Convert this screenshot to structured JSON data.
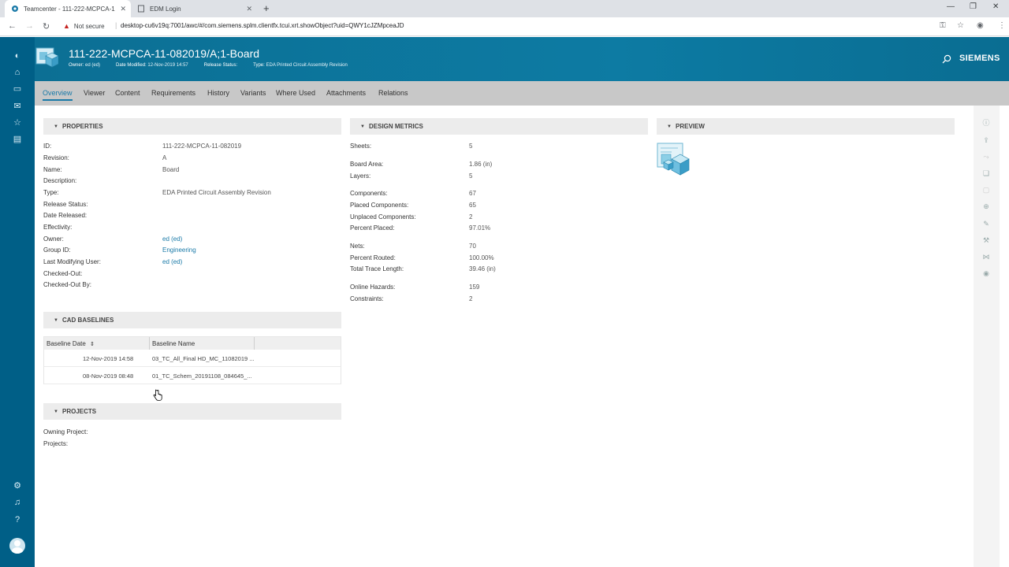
{
  "browser": {
    "tabs": [
      {
        "title": "Teamcenter - 111-222-MCPCA-1",
        "close": "✕"
      },
      {
        "title": "EDM Login",
        "close": "✕"
      }
    ],
    "new_tab": "+",
    "secure_label": "Not secure",
    "url": "desktop-cu6v19q:7001/awc/#/com.siemens.splm.clientfx.tcui.xrt.showObject?uid=QWY1cJZMpceaJD"
  },
  "header": {
    "title": "111-222-MCPCA-11-082019/A;1-Board",
    "meta": [
      {
        "label": "Owner:",
        "value": "ed (ed)"
      },
      {
        "label": "Date Modified:",
        "value": "12-Nov-2019 14:57"
      },
      {
        "label": "Release Status:",
        "value": ""
      },
      {
        "label": "Type:",
        "value": "EDA Printed Circuit Assembly Revision"
      }
    ],
    "brand": "SIEMENS"
  },
  "subtabs": [
    "Overview",
    "Viewer",
    "Content",
    "Requirements",
    "History",
    "Variants",
    "Where Used",
    "Attachments",
    "Relations"
  ],
  "properties": {
    "title": "PROPERTIES",
    "rows": [
      {
        "label": "ID:",
        "value": "111-222-MCPCA-11-082019"
      },
      {
        "label": "Revision:",
        "value": "A"
      },
      {
        "label": "Name:",
        "value": "Board"
      },
      {
        "label": "Description:",
        "value": ""
      },
      {
        "label": "Type:",
        "value": "EDA Printed Circuit Assembly Revision"
      },
      {
        "label": "Release Status:",
        "value": ""
      },
      {
        "label": "Date Released:",
        "value": ""
      },
      {
        "label": "Effectivity:",
        "value": ""
      },
      {
        "label": "Owner:",
        "value": "ed (ed)"
      },
      {
        "label": "Group ID:",
        "value": "Engineering"
      },
      {
        "label": "Last Modifying User:",
        "value": "ed (ed)"
      },
      {
        "label": "Checked-Out:",
        "value": ""
      },
      {
        "label": "Checked-Out By:",
        "value": ""
      }
    ]
  },
  "design_metrics": {
    "title": "DESIGN METRICS",
    "rows": [
      {
        "label": "Sheets:",
        "value": "5"
      },
      {
        "label": "Board Area:",
        "value": "1.86 (in)"
      },
      {
        "label": "Layers:",
        "value": "5"
      },
      {
        "label": "Components:",
        "value": "67"
      },
      {
        "label": "Placed Components:",
        "value": "65"
      },
      {
        "label": "Unplaced Components:",
        "value": "2"
      },
      {
        "label": "Percent Placed:",
        "value": "97.01%"
      },
      {
        "label": "Nets:",
        "value": "70"
      },
      {
        "label": "Percent Routed:",
        "value": "100.00%"
      },
      {
        "label": "Total Trace Length:",
        "value": "39.46 (in)"
      },
      {
        "label": "Online Hazards:",
        "value": "159"
      },
      {
        "label": "Constraints:",
        "value": "2"
      }
    ]
  },
  "preview": {
    "title": "PREVIEW"
  },
  "cad_baselines": {
    "title": "CAD BASELINES",
    "columns": [
      "Baseline Date",
      "Baseline Name"
    ],
    "sort_indicator": "⇕",
    "rows": [
      {
        "date": "12-Nov-2019 14:58",
        "name": "03_TC_All_Final HD_MC_11082019 ..."
      },
      {
        "date": "08-Nov-2019 08:48",
        "name": "01_TC_Schem_20191108_084645_..."
      }
    ]
  },
  "projects": {
    "title": "PROJECTS",
    "rows": [
      {
        "label": "Owning Project:",
        "value": ""
      },
      {
        "label": "Projects:",
        "value": ""
      }
    ]
  },
  "colors": {
    "rail": "#005f87",
    "header": "#0d7ba3",
    "subtabs": "#c8c8c8",
    "link": "#1a7aa8"
  }
}
